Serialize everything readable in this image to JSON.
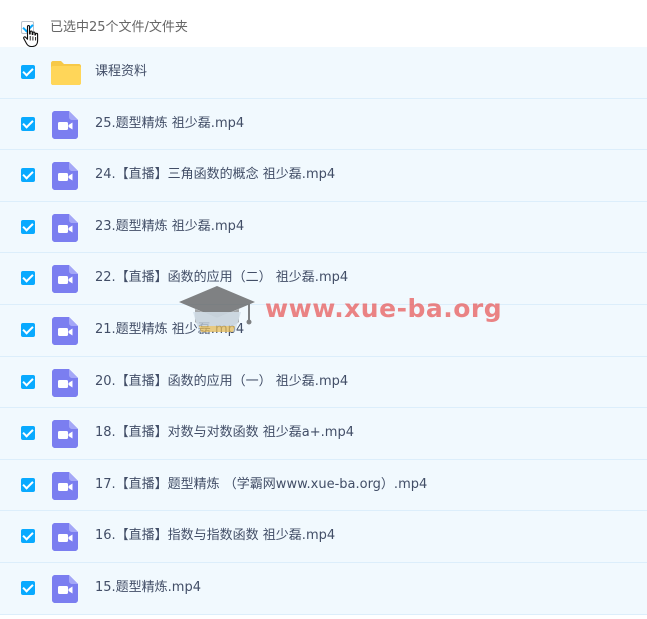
{
  "header": {
    "selection_text": "已选中25个文件/文件夹",
    "checkbox_state": "partial"
  },
  "colors": {
    "accent": "#09aaff",
    "row_bg": "#f1f9fe",
    "video_icon": "#7b7ef0",
    "folder_icon": "#ffd659"
  },
  "rows": [
    {
      "name": "课程资料",
      "type": "folder",
      "checked": true,
      "icon": "folder-icon"
    },
    {
      "name": "25.题型精炼 祖少磊.mp4",
      "type": "video",
      "checked": true,
      "icon": "video-file-icon"
    },
    {
      "name": "24.【直播】三角函数的概念 祖少磊.mp4",
      "type": "video",
      "checked": true,
      "icon": "video-file-icon"
    },
    {
      "name": "23.题型精炼 祖少磊.mp4",
      "type": "video",
      "checked": true,
      "icon": "video-file-icon"
    },
    {
      "name": "22.【直播】函数的应用（二） 祖少磊.mp4",
      "type": "video",
      "checked": true,
      "icon": "video-file-icon"
    },
    {
      "name": "21.题型精炼 祖少磊.mp4",
      "type": "video",
      "checked": true,
      "icon": "video-file-icon"
    },
    {
      "name": "20.【直播】函数的应用（一） 祖少磊.mp4",
      "type": "video",
      "checked": true,
      "icon": "video-file-icon"
    },
    {
      "name": "18.【直播】对数与对数函数 祖少磊a+.mp4",
      "type": "video",
      "checked": true,
      "icon": "video-file-icon"
    },
    {
      "name": "17.【直播】题型精炼 （学霸网www.xue-ba.org）.mp4",
      "type": "video",
      "checked": true,
      "icon": "video-file-icon"
    },
    {
      "name": "16.【直播】指数与指数函数 祖少磊.mp4",
      "type": "video",
      "checked": true,
      "icon": "video-file-icon"
    },
    {
      "name": "15.题型精炼.mp4",
      "type": "video",
      "checked": true,
      "icon": "video-file-icon"
    }
  ],
  "watermark": {
    "text": "www.xue-ba.org"
  }
}
